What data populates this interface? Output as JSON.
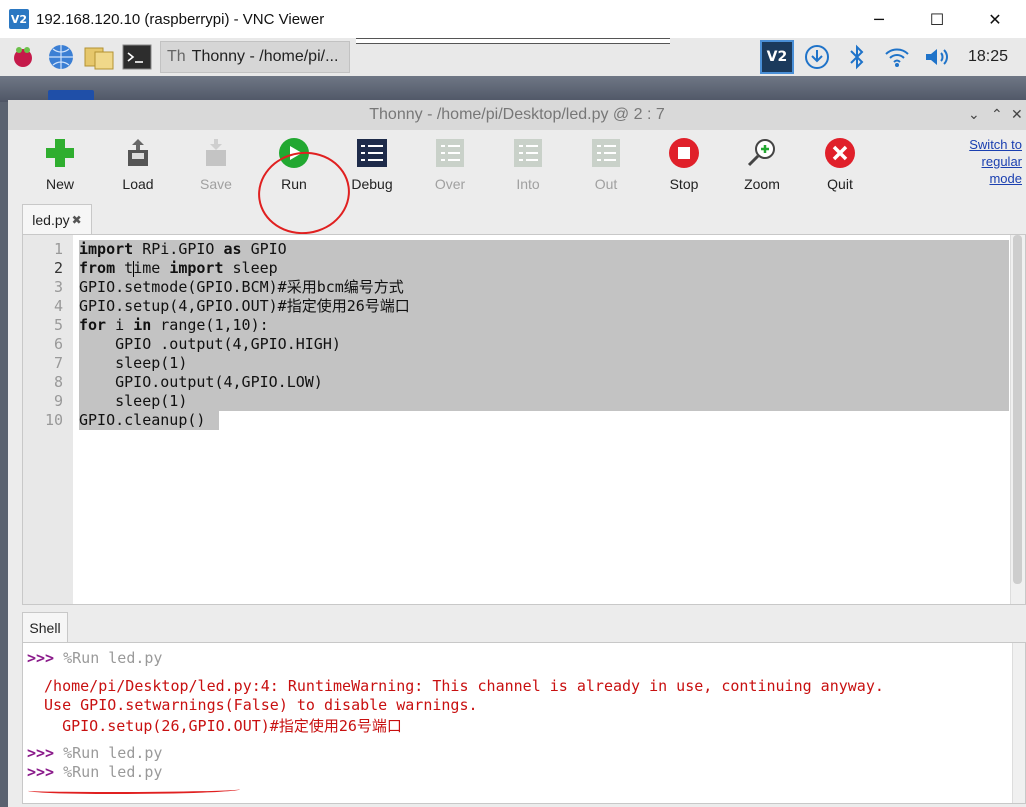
{
  "vnc": {
    "title": "192.168.120.10 (raspberrypi) - VNC Viewer",
    "logo": "V2",
    "controls": {
      "minimize": "─",
      "maximize": "☐",
      "close": "✕"
    }
  },
  "taskbar": {
    "task_label": "Thonny  -  /home/pi/...",
    "clock": "18:25",
    "tray_icons": [
      "vnc-icon",
      "download-icon",
      "bluetooth-icon",
      "wifi-icon",
      "volume-icon"
    ]
  },
  "thonny": {
    "title": "Thonny  -  /home/pi/Desktop/led.py  @  2 : 7",
    "toolbar": {
      "new": "New",
      "load": "Load",
      "save": "Save",
      "run": "Run",
      "debug": "Debug",
      "over": "Over",
      "into": "Into",
      "out": "Out",
      "stop": "Stop",
      "zoom": "Zoom",
      "quit": "Quit"
    },
    "switch_mode": [
      "Switch to",
      "regular",
      "mode"
    ],
    "editor_tab": "led.py",
    "editor_tab_close": "✖",
    "line_numbers": [
      "1",
      "2",
      "3",
      "4",
      "5",
      "6",
      "7",
      "8",
      "9",
      "10"
    ],
    "code": [
      {
        "kw1": "import",
        "mid": " RPi.GPIO ",
        "kw2": "as",
        "rest": " GPIO"
      },
      {
        "kw1": "from",
        "pre": " t",
        "post": "ime ",
        "kw2": "import",
        "rest": " sleep"
      },
      {
        "text": "GPIO.setmode(GPIO.BCM)#采用bcm编号方式"
      },
      {
        "text": "GPIO.setup(4,GPIO.OUT)#指定使用26号端口"
      },
      {
        "kw1": "for",
        "mid": " i ",
        "kw2": "in",
        "rest": " range(1,10):"
      },
      {
        "text": "    GPIO .output(4,GPIO.HIGH)"
      },
      {
        "text": "    sleep(1)"
      },
      {
        "text": "    GPIO.output(4,GPIO.LOW)"
      },
      {
        "text": "    sleep(1)"
      },
      {
        "text": "GPIO.cleanup()"
      }
    ],
    "shell_tab": "Shell",
    "shell": {
      "prompt": ">>>",
      "cmd1": " %Run led.py",
      "err1": " /home/pi/Desktop/led.py:4: RuntimeWarning: This channel is already in use, continuing anyway.",
      "err2": " Use GPIO.setwarnings(False) to disable warnings.",
      "err3": "   GPIO.setup(26,GPIO.OUT)#指定使用26号端口",
      "cmd2": " %Run led.py",
      "cmd3": " %Run led.py"
    }
  }
}
